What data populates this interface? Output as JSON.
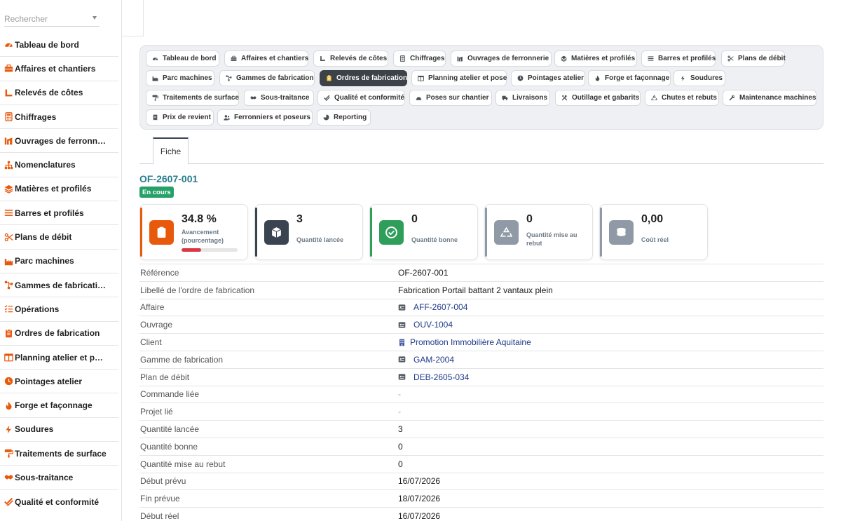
{
  "search": {
    "placeholder": "Rechercher"
  },
  "colors": {
    "accent": "#e8590c",
    "title": "#2a7d8c",
    "status_green": "#26a269",
    "active_module": "#3d4148",
    "link": "#1e3a8a"
  },
  "sidebar": {
    "items": [
      {
        "label": "Tableau de bord",
        "icon": "gauge-icon"
      },
      {
        "label": "Affaires et chantiers",
        "icon": "toolbox-icon"
      },
      {
        "label": "Relevés de côtes",
        "icon": "ruler-icon"
      },
      {
        "label": "Chiffrages",
        "icon": "calculator-icon"
      },
      {
        "label": "Ouvrages de ferronn…",
        "icon": "gate-icon"
      },
      {
        "label": "Nomenclatures",
        "icon": "sitemap-icon"
      },
      {
        "label": "Matières et profilés",
        "icon": "layers-icon"
      },
      {
        "label": "Barres et profilés",
        "icon": "bars-icon"
      },
      {
        "label": "Plans de débit",
        "icon": "scissors-icon"
      },
      {
        "label": "Parc machines",
        "icon": "industry-icon"
      },
      {
        "label": "Gammes de fabricati…",
        "icon": "diagram-icon"
      },
      {
        "label": "Opérations",
        "icon": "list-check-icon"
      },
      {
        "label": "Ordres de fabrication",
        "icon": "clipboard-icon"
      },
      {
        "label": "Planning atelier et p…",
        "icon": "calendar-icon"
      },
      {
        "label": "Pointages atelier",
        "icon": "clock-icon"
      },
      {
        "label": "Forge et façonnage",
        "icon": "flame-icon"
      },
      {
        "label": "Soudures",
        "icon": "bolt-icon"
      },
      {
        "label": "Traitements de surface",
        "icon": "paint-roller-icon"
      },
      {
        "label": "Sous-traitance",
        "icon": "handshake-icon"
      },
      {
        "label": "Qualité et conformité",
        "icon": "check-double-icon"
      }
    ]
  },
  "modules": [
    {
      "label": "Tableau de bord",
      "icon": "gauge-icon"
    },
    {
      "label": "Affaires et chantiers",
      "icon": "toolbox-icon"
    },
    {
      "label": "Relevés de côtes",
      "icon": "ruler-icon"
    },
    {
      "label": "Chiffrages",
      "icon": "calculator-icon"
    },
    {
      "label": "Ouvrages de ferronnerie",
      "icon": "gate-icon"
    },
    {
      "label": "Matières et profilés",
      "icon": "layers-icon"
    },
    {
      "label": "Barres et profilés",
      "icon": "bars-icon"
    },
    {
      "label": "Plans de débit",
      "icon": "scissors-icon"
    },
    {
      "label": "Parc machines",
      "icon": "industry-icon"
    },
    {
      "label": "Gammes de fabrication",
      "icon": "diagram-icon"
    },
    {
      "label": "Ordres de fabrication",
      "icon": "clipboard-icon",
      "active": true
    },
    {
      "label": "Planning atelier et pose",
      "icon": "calendar-icon"
    },
    {
      "label": "Pointages atelier",
      "icon": "clock-icon"
    },
    {
      "label": "Forge et façonnage",
      "icon": "flame-icon"
    },
    {
      "label": "Soudures",
      "icon": "bolt-icon"
    },
    {
      "label": "Traitements de surface",
      "icon": "paint-roller-icon"
    },
    {
      "label": "Sous-traitance",
      "icon": "handshake-icon"
    },
    {
      "label": "Qualité et conformité",
      "icon": "check-double-icon"
    },
    {
      "label": "Poses sur chantier",
      "icon": "helmet-icon"
    },
    {
      "label": "Livraisons",
      "icon": "truck-icon"
    },
    {
      "label": "Outillage et gabarits",
      "icon": "tools-icon"
    },
    {
      "label": "Chutes et rebuts",
      "icon": "recycle-icon"
    },
    {
      "label": "Maintenance machines",
      "icon": "wrench-icon"
    },
    {
      "label": "Prix de revient",
      "icon": "receipt-icon"
    },
    {
      "label": "Ferronniers et poseurs",
      "icon": "users-icon"
    },
    {
      "label": "Reporting",
      "icon": "pie-chart-icon"
    }
  ],
  "tabs": [
    {
      "label": "Fiche"
    }
  ],
  "record": {
    "title": "OF-2607-001",
    "status": "En cours"
  },
  "kpis": [
    {
      "value": "34.8 %",
      "label_lines": [
        "Avancement",
        "(pourcentage)"
      ],
      "icon": "clipboard-icon",
      "color": "#e8590c",
      "progress": 0.348
    },
    {
      "value": "3",
      "label_lines": [
        "Quantité lancée"
      ],
      "icon": "box-icon",
      "color": "#3a4350"
    },
    {
      "value": "0",
      "label_lines": [
        "Quantité bonne"
      ],
      "icon": "check-circle-icon",
      "color": "#2f9e5b"
    },
    {
      "value": "0",
      "label_lines": [
        "Quantité mise au",
        "rebut"
      ],
      "icon": "recycle-icon",
      "color": "#8f9aa6"
    },
    {
      "value": "0,00",
      "label_lines": [
        "Coût réel"
      ],
      "icon": "coins-icon",
      "color": "#8f9aa6"
    }
  ],
  "fields": [
    {
      "label": "Référence",
      "value": "OF-2607-001",
      "type": "text"
    },
    {
      "label": "Libellé de l'ordre de fabrication",
      "value": "Fabrication Portail battant 2 vantaux plein",
      "type": "text"
    },
    {
      "label": "Affaire",
      "value": "AFF-2607-004",
      "type": "link",
      "icon": "record-icon"
    },
    {
      "label": "Ouvrage",
      "value": "OUV-1004",
      "type": "link",
      "icon": "record-icon"
    },
    {
      "label": "Client",
      "value": "Promotion Immobilière Aquitaine",
      "type": "link",
      "icon": "building-icon"
    },
    {
      "label": "Gamme de fabrication",
      "value": "GAM-2004",
      "type": "link",
      "icon": "record-icon"
    },
    {
      "label": "Plan de débit",
      "value": "DEB-2605-034",
      "type": "link",
      "icon": "record-icon"
    },
    {
      "label": "Commande liée",
      "value": "-",
      "type": "empty"
    },
    {
      "label": "Projet lié",
      "value": "-",
      "type": "empty"
    },
    {
      "label": "Quantité lancée",
      "value": "3",
      "type": "text"
    },
    {
      "label": "Quantité bonne",
      "value": "0",
      "type": "text"
    },
    {
      "label": "Quantité mise au rebut",
      "value": "0",
      "type": "text"
    },
    {
      "label": "Début prévu",
      "value": "16/07/2026",
      "type": "text"
    },
    {
      "label": "Fin prévue",
      "value": "18/07/2026",
      "type": "text"
    },
    {
      "label": "Début réel",
      "value": "16/07/2026",
      "type": "text"
    }
  ]
}
